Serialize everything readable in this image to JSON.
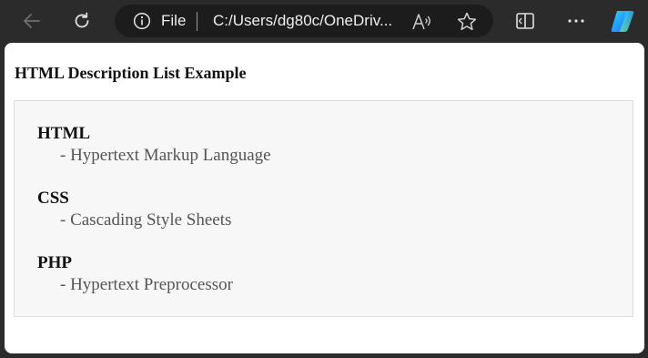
{
  "browser": {
    "address_scheme": "File",
    "address_url": "C:/Users/dg80c/OneDriv...",
    "icons": {
      "back": "back-arrow-icon",
      "refresh": "refresh-icon",
      "info": "info-icon",
      "read_aloud": "read-aloud-icon",
      "favorite": "star-icon",
      "split_screen": "split-screen-icon",
      "more": "more-icon",
      "copilot": "copilot-icon"
    }
  },
  "page": {
    "title": "HTML Description List Example",
    "items": [
      {
        "term": "HTML",
        "description": "- Hypertext Markup Language"
      },
      {
        "term": "CSS",
        "description": "- Cascading Style Sheets"
      },
      {
        "term": "PHP",
        "description": "- Hypertext Preprocessor"
      }
    ]
  },
  "colors": {
    "chrome_bg": "#2b2b2b",
    "address_bg": "#1c1c1c",
    "page_bg": "#ffffff",
    "list_box_bg": "#f7f7f7",
    "description_text": "#555555"
  }
}
